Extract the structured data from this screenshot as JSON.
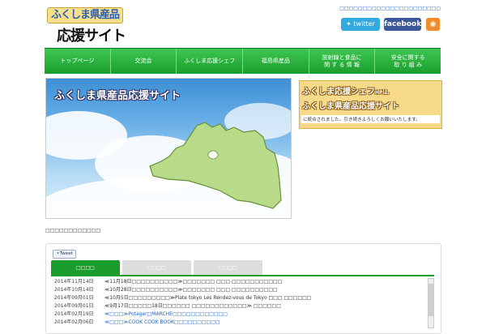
{
  "header": {
    "logo_top": "ふくしま県産品",
    "logo_bottom": "応援サイト",
    "tagline": "□□□□□□□□□□□□□□□□□□□□□□",
    "twitter_label": "twitter",
    "facebook_label": "facebook"
  },
  "nav": {
    "items": [
      {
        "label": "トップページ"
      },
      {
        "label": "交流会"
      },
      {
        "label": "ふくしま応援シェフ"
      },
      {
        "label": "福島県産品"
      },
      {
        "label": "放射線と食品に\n関 す る 情 報"
      },
      {
        "label": "安全に関する\n取 り 組 み"
      }
    ]
  },
  "hero": {
    "title": "ふくしま県産品応援サイト"
  },
  "banner": {
    "line1": "ふくしま応援シェフ",
    "line1_small": "HPは、",
    "line2": "ふくしま県産品応援サイト",
    "line3": "に統合されました。引き続きよろしくお願いいたします。"
  },
  "section": {
    "label": "□□□□□□□□□□□□"
  },
  "news": {
    "tweet_label": "Tweet",
    "tabs": [
      {
        "label": "□□□□"
      },
      {
        "label": "□□□□"
      },
      {
        "label": "□□□□"
      }
    ],
    "items": [
      {
        "date": "2014年11月14日",
        "text": "≪11月18日□□□□□□□□□□≫□□□□□□□ □□□ □□□□□□□□□□□",
        "link": false
      },
      {
        "date": "2014年10月14日",
        "text": "≪10月28日□□□□□□□□□□≫□□□□□□□ □□□ □□□□□□□□□□",
        "link": false
      },
      {
        "date": "2014年09月01日",
        "text": "≪10月5日□□□□□□□□□≫Plate tokyo Les Rendez-vous de Tokyo □□□ □□□□□□",
        "link": false
      },
      {
        "date": "2014年09月01日",
        "text": "≪9月17日□□□□□18日□□□□□□ □□□□□□□□□□□□≫ □□□□□□",
        "link": false
      },
      {
        "date": "2014年02月19日",
        "text": "≪□□□≫Potager□MARCHE□□□□□□□□□□□□",
        "link": true
      },
      {
        "date": "2014年02月06日",
        "text": "≪□□□≫COOK COOK BOOK□□□□□□□□□□",
        "link": true
      }
    ]
  },
  "colors": {
    "nav_green": "#1a9d2c",
    "twitter": "#33aadd",
    "facebook": "#3b5998",
    "rss": "#f08c2c"
  }
}
